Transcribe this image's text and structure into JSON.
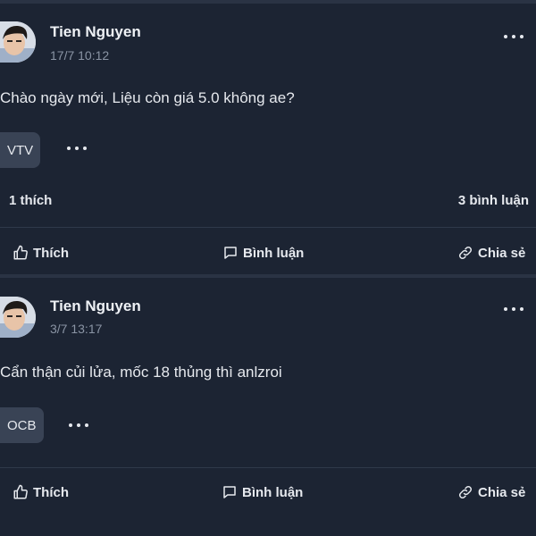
{
  "posts": [
    {
      "author": "Tien Nguyen",
      "timestamp": "17/7 10:12",
      "content": "Chào ngày mới, Liệu còn giá 5.0 không ae?",
      "tag": "VTV",
      "likes": "1 thích",
      "comments": "3 bình luận",
      "actions": {
        "like": "Thích",
        "comment": "Bình luận",
        "share": "Chia sẻ"
      }
    },
    {
      "author": "Tien Nguyen",
      "timestamp": "3/7 13:17",
      "content": "Cẩn thận củi lửa, mốc 18 thủng thì anlzroi",
      "tag": "OCB",
      "actions": {
        "like": "Thích",
        "comment": "Bình luận",
        "share": "Chia sẻ"
      }
    }
  ],
  "icons": {
    "more": "more-horizontal-icon",
    "like": "thumbs-up-icon",
    "comment": "comment-bubble-icon",
    "share": "link-chain-icon"
  },
  "colors": {
    "background": "#1c2433",
    "chip": "#394355",
    "muted_text": "#8a94a4"
  }
}
